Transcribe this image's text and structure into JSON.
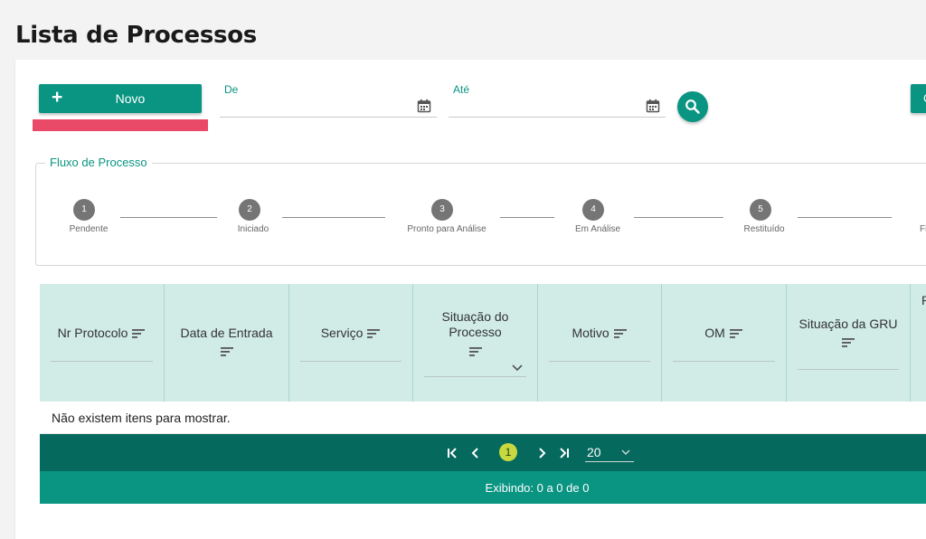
{
  "page": {
    "title": "Lista de Processos"
  },
  "toolbar": {
    "new_label": "Novo",
    "right_button_label": "C"
  },
  "filters": {
    "from_label": "De",
    "to_label": "Até"
  },
  "flow": {
    "legend": "Fluxo de Processo",
    "steps": [
      {
        "number": "1",
        "label": "Pendente"
      },
      {
        "number": "2",
        "label": "Iniciado"
      },
      {
        "number": "3",
        "label": "Pronto para Análise"
      },
      {
        "number": "4",
        "label": "Em Análise"
      },
      {
        "number": "5",
        "label": "Restituído"
      },
      {
        "number": "",
        "label": "Fi"
      }
    ]
  },
  "table": {
    "columns": [
      "Nr Protocolo",
      "Data de Entrada",
      "Serviço",
      "Situação do Processo",
      "Motivo",
      "OM",
      "Situação da GRU",
      "P"
    ],
    "empty_message": "Não existem itens para mostrar."
  },
  "pagination": {
    "current_page": "1",
    "page_size": "20",
    "summary": "Exibindo: 0 a 0 de 0"
  },
  "colors": {
    "primary": "#0a9482",
    "dark": "#05695e",
    "header_bg": "#d1ece7",
    "highlight": "#e94a67",
    "page_active": "#c7d93e"
  }
}
